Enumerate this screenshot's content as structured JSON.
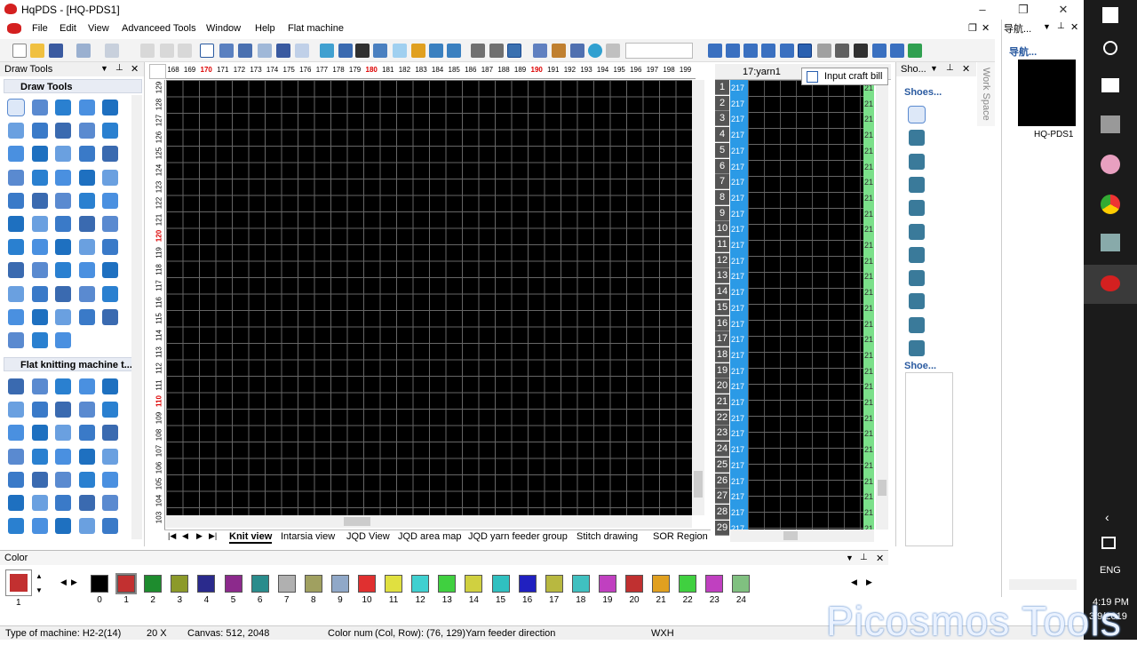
{
  "window": {
    "title": "HqPDS - [HQ-PDS1]",
    "minimize": "–",
    "restore": "❐",
    "close": "✕"
  },
  "menu": [
    "File",
    "Edit",
    "View",
    "Advanceed Tools",
    "Window",
    "Help",
    "Flat machine"
  ],
  "mdi": {
    "restore": "❐",
    "close": "✕"
  },
  "draw_tools": {
    "title": "Draw Tools",
    "group1": "Draw Tools",
    "group2": "Flat knitting machine t..."
  },
  "ruler_top": [
    "168",
    "169",
    "170",
    "171",
    "172",
    "173",
    "174",
    "175",
    "176",
    "177",
    "178",
    "179",
    "180",
    "181",
    "182",
    "183",
    "184",
    "185",
    "186",
    "187",
    "188",
    "189",
    "190",
    "191",
    "192",
    "193",
    "194",
    "195",
    "196",
    "197",
    "198",
    "199"
  ],
  "ruler_left": [
    "129",
    "128",
    "127",
    "126",
    "125",
    "124",
    "123",
    "122",
    "121",
    "120",
    "119",
    "118",
    "117",
    "116",
    "115",
    "114",
    "113",
    "112",
    "111",
    "110",
    "109",
    "108",
    "107",
    "106",
    "105",
    "104",
    "103"
  ],
  "tabs": [
    "Knit view",
    "Intarsia view",
    "JQD View",
    "JQD area map",
    "JQD yarn feeder group",
    "Stitch drawing",
    "SOR Region"
  ],
  "yarn": {
    "header": "17:yarn1",
    "value": "217",
    "green": "21",
    "rows": [
      "1",
      "2",
      "3",
      "4",
      "5",
      "6",
      "7",
      "8",
      "9",
      "10",
      "11",
      "12",
      "13",
      "14",
      "15",
      "16",
      "17",
      "18",
      "19",
      "20",
      "21",
      "22",
      "23",
      "24",
      "25",
      "26",
      "27",
      "28",
      "29"
    ]
  },
  "tooltip": "Input craft bill",
  "shoes": {
    "head1": "Sho...",
    "sub1": "Shoes...",
    "sub2": "Shoe..."
  },
  "workspace": "Work Space",
  "nav": {
    "title": "导航...",
    "thumb_label": "HQ-PDS1"
  },
  "taskbar": {
    "lang": "ENG",
    "time": "4:19 PM",
    "date": "3/9/2019"
  },
  "color": {
    "title": "Color",
    "selected_index": "1",
    "swatches": [
      {
        "n": "0",
        "c": "#000000"
      },
      {
        "n": "1",
        "c": "#c23030"
      },
      {
        "n": "2",
        "c": "#1e8c2e"
      },
      {
        "n": "3",
        "c": "#8c9a2a"
      },
      {
        "n": "4",
        "c": "#2a2a8c"
      },
      {
        "n": "5",
        "c": "#8c2a8c"
      },
      {
        "n": "6",
        "c": "#2a8c8c"
      },
      {
        "n": "7",
        "c": "#b0b0b0"
      },
      {
        "n": "8",
        "c": "#a0a060"
      },
      {
        "n": "9",
        "c": "#90a8c8"
      },
      {
        "n": "10",
        "c": "#e03030"
      },
      {
        "n": "11",
        "c": "#e0e040"
      },
      {
        "n": "12",
        "c": "#40d0d0"
      },
      {
        "n": "13",
        "c": "#40d040"
      },
      {
        "n": "14",
        "c": "#d0d040"
      },
      {
        "n": "15",
        "c": "#30c0c0"
      },
      {
        "n": "16",
        "c": "#2020c0"
      },
      {
        "n": "17",
        "c": "#b8b840"
      },
      {
        "n": "18",
        "c": "#40c0c0"
      },
      {
        "n": "19",
        "c": "#c040c0"
      },
      {
        "n": "20",
        "c": "#c03030"
      },
      {
        "n": "21",
        "c": "#e0a020"
      },
      {
        "n": "22",
        "c": "#40d040"
      },
      {
        "n": "23",
        "c": "#c040c0"
      },
      {
        "n": "24",
        "c": "#80c080"
      }
    ]
  },
  "status": {
    "machine": "Type of machine: H2-2(14)",
    "zoom": "20 X",
    "canvas": "Canvas: 512, 2048",
    "colornum": "Color num",
    "colrow": "(Col, Row): (76, 129)Yarn feeder direction",
    "wxh": "WXH"
  },
  "watermark": "Picosmos Tools"
}
